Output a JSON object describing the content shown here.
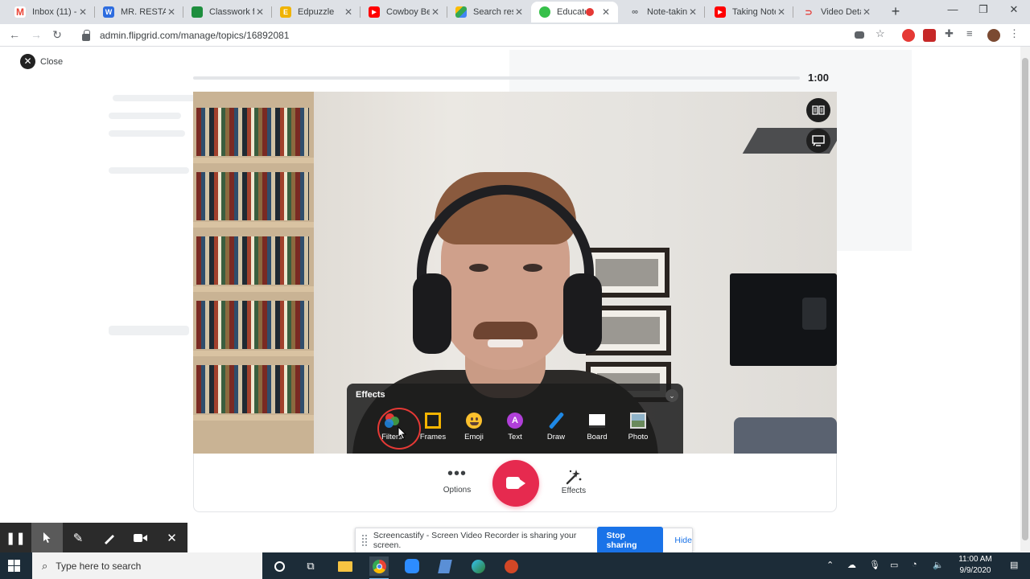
{
  "browser": {
    "tabs": [
      {
        "title": "Inbox (11) -",
        "favicon": "gmail-icon",
        "color": "#ea4335"
      },
      {
        "title": "MR. RESTAD",
        "favicon": "weebly-icon",
        "color": "#2d6cdf"
      },
      {
        "title": "Classwork fo",
        "favicon": "classroom-icon",
        "color": "#1e8e3e"
      },
      {
        "title": "Edpuzzle",
        "favicon": "edpuzzle-icon",
        "color": "#f0b300"
      },
      {
        "title": "Cowboy Beb",
        "favicon": "youtube-icon",
        "color": "#ff0000"
      },
      {
        "title": "Search resul",
        "favicon": "drive-icon",
        "color": "#34a853"
      },
      {
        "title": "Educato",
        "favicon": "flipgrid-icon",
        "color": "#37c04a",
        "active": true
      },
      {
        "title": "Note-taking",
        "favicon": "link-icon",
        "color": "#5f6368"
      },
      {
        "title": "Taking Note",
        "favicon": "youtube-icon",
        "color": "#ff0000"
      },
      {
        "title": "Video Detai",
        "favicon": "video-icon",
        "color": "#e53935"
      }
    ],
    "url": "admin.flipgrid.com/manage/topics/16892081"
  },
  "recorder": {
    "close_label": "Close",
    "timer": "1:00",
    "recording_progress": 0
  },
  "effects": {
    "title": "Effects",
    "items": [
      {
        "label": "Filters",
        "icon": "filters-icon"
      },
      {
        "label": "Frames",
        "icon": "frames-icon"
      },
      {
        "label": "Emoji",
        "icon": "emoji-icon"
      },
      {
        "label": "Text",
        "icon": "text-icon"
      },
      {
        "label": "Draw",
        "icon": "draw-icon"
      },
      {
        "label": "Board",
        "icon": "board-icon"
      },
      {
        "label": "Photo",
        "icon": "photo-icon"
      }
    ],
    "text_icon_letter": "A"
  },
  "controls": {
    "options_label": "Options",
    "effects_label": "Effects"
  },
  "screencastify": {
    "message": "Screencastify - Screen Video Recorder is sharing your screen.",
    "stop_label": "Stop sharing",
    "hide_label": "Hide"
  },
  "taskbar": {
    "search_placeholder": "Type here to search",
    "time": "11:00 AM",
    "date": "9/9/2020"
  },
  "colors": {
    "record": "#e62a4f",
    "accent_blue": "#1a73e8",
    "taskbar": "#1c2c38"
  }
}
